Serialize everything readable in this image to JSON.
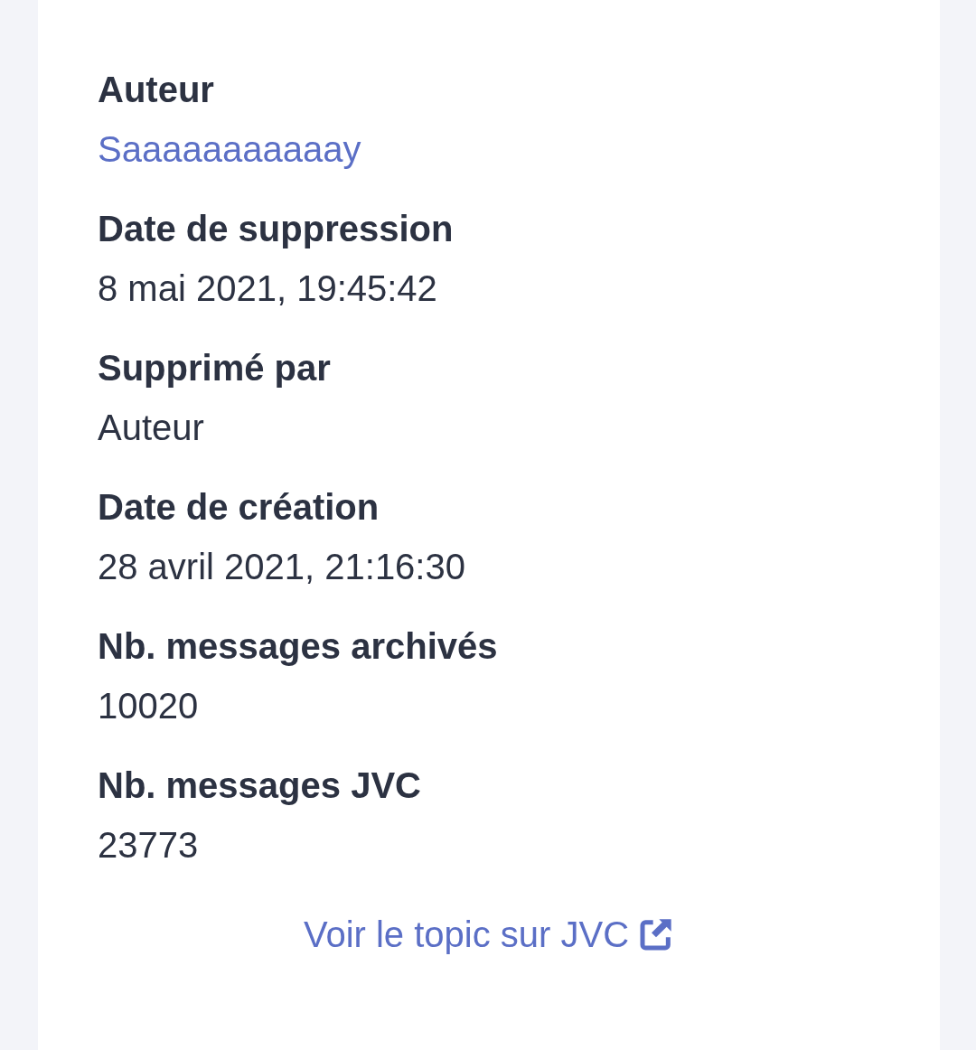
{
  "fields": [
    {
      "label": "Auteur",
      "value": "Saaaaaaaaaaay",
      "kind": "link"
    },
    {
      "label": "Date de suppression",
      "value": "8 mai 2021, 19:45:42",
      "kind": "text"
    },
    {
      "label": "Supprimé par",
      "value": "Auteur",
      "kind": "text"
    },
    {
      "label": "Date de création",
      "value": "28 avril 2021, 21:16:30",
      "kind": "text"
    },
    {
      "label": "Nb. messages archivés",
      "value": "10020",
      "kind": "text"
    },
    {
      "label": "Nb. messages JVC",
      "value": "23773",
      "kind": "text"
    }
  ],
  "topic_link": {
    "label": "Voir le topic sur JVC"
  }
}
